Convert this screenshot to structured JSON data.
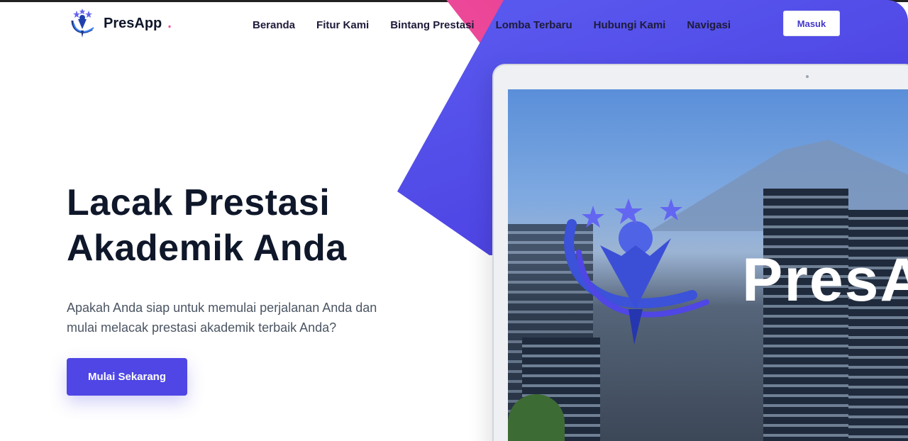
{
  "brand": {
    "name": "PresApp",
    "dot": ".",
    "accent": "#4f46e5",
    "accent2": "#ec4899"
  },
  "nav": {
    "items": [
      {
        "label": "Beranda"
      },
      {
        "label": "Fitur Kami"
      },
      {
        "label": "Bintang Prestasi"
      },
      {
        "label": "Lomba Terbaru"
      },
      {
        "label": "Hubungi Kami"
      },
      {
        "label": "Navigasi"
      }
    ],
    "login_label": "Masuk"
  },
  "hero": {
    "title_line1": "Lacak Prestasi",
    "title_line2": "Akademik Anda",
    "subtitle_line1": "Apakah Anda siap untuk memulai perjalanan Anda dan",
    "subtitle_line2": "mulai melacak prestasi akademik terbaik Anda?",
    "cta_label": "Mulai Sekarang"
  },
  "mockup": {
    "screen_text": "PresApp",
    "icon": "presapp-logo-icon"
  }
}
